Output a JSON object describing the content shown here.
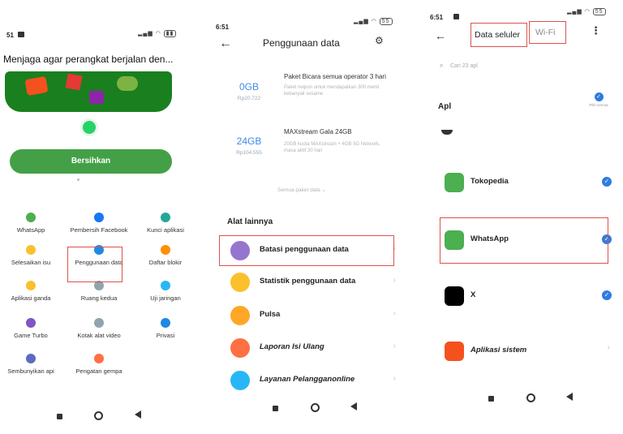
{
  "screen1": {
    "status_time": "51",
    "header_title": "Menjaga agar perangkat berjalan den...",
    "clean_button": "Bersihkan",
    "grid": [
      {
        "label": "WhatsApp",
        "icon": "whatsapp-icon",
        "color": "#4caf50"
      },
      {
        "label": "Pembersih Facebook",
        "icon": "facebook-icon",
        "color": "#1877f2"
      },
      {
        "label": "Kunci aplikasi",
        "icon": "shield-icon",
        "color": "#26a69a"
      },
      {
        "label": "Selesaikan isu",
        "icon": "wrench-icon",
        "color": "#fbc02d"
      },
      {
        "label": "Penggunaan data",
        "icon": "data-usage-icon",
        "color": "#1e88e5"
      },
      {
        "label": "Daftar blokir",
        "icon": "block-icon",
        "color": "#ff8f00"
      },
      {
        "label": "Aplikasi ganda",
        "icon": "dual-apps-icon",
        "color": "#fbc02d"
      },
      {
        "label": "Ruang kedua",
        "icon": "second-space-icon",
        "color": "#90a4ae"
      },
      {
        "label": "Uji jaringan",
        "icon": "network-test-icon",
        "color": "#29b6f6"
      },
      {
        "label": "Game Turbo",
        "icon": "gamepad-icon",
        "color": "#7e57c2"
      },
      {
        "label": "Kotak alat video",
        "icon": "video-toolbox-icon",
        "color": "#90a4ae"
      },
      {
        "label": "Privasi",
        "icon": "privacy-icon",
        "color": "#1e88e5"
      },
      {
        "label": "Sembunyikan api",
        "icon": "hide-apps-icon",
        "color": "#5c6bc0"
      },
      {
        "label": "Pengatan gempa",
        "icon": "earthquake-icon",
        "color": "#ff7043"
      }
    ]
  },
  "screen2": {
    "status_time": "6:51",
    "title": "Penggunaan data",
    "packages": [
      {
        "price": "0GB",
        "sub": "Rp20.722",
        "name": "Paket Bicara semua operator 3 hari",
        "desc": "Paket nelpon untuk mendapatkan 300 menit kebanyak sesame"
      },
      {
        "price": "24GB",
        "sub": "Rp104.555",
        "name": "MAXstream Gala 24GB",
        "desc": "20GB kuota MAXstream + 4GB 5G Network, masa aktif 30 hari"
      }
    ],
    "more_packages": "Semua paket data",
    "section_title": "Alat lainnya",
    "tools": [
      {
        "label": "Batasi penggunaan data",
        "icon": "limit-data-icon",
        "color": "#9575cd"
      },
      {
        "label": "Statistik penggunaan data",
        "icon": "statistics-icon",
        "color": "#fbc02d"
      },
      {
        "label": "Pulsa",
        "icon": "balance-icon",
        "color": "#ffa726"
      },
      {
        "label": "Laporan Isi Ulang",
        "icon": "recharge-report-icon",
        "color": "#ff7043"
      },
      {
        "label": "Layanan Pelangganonline",
        "icon": "customer-service-icon",
        "color": "#29b6f6"
      }
    ]
  },
  "screen3": {
    "status_time": "6:51",
    "tab_cellular": "Data seluler",
    "tab_wifi": "Wi-Fi",
    "search_placeholder": "Cari 23 apl",
    "section_label": "Apl",
    "select_all": "Pilih semua",
    "apps": [
      {
        "label": "Tokopedia",
        "icon": "tokopedia-icon",
        "color": "#4caf50"
      },
      {
        "label": "WhatsApp",
        "icon": "whatsapp-icon",
        "color": "#4caf50"
      },
      {
        "label": "X",
        "icon": "x-icon",
        "color": "#000000"
      },
      {
        "label": "Aplikasi sistem",
        "icon": "system-apps-icon",
        "color": "#f4511e"
      }
    ]
  }
}
